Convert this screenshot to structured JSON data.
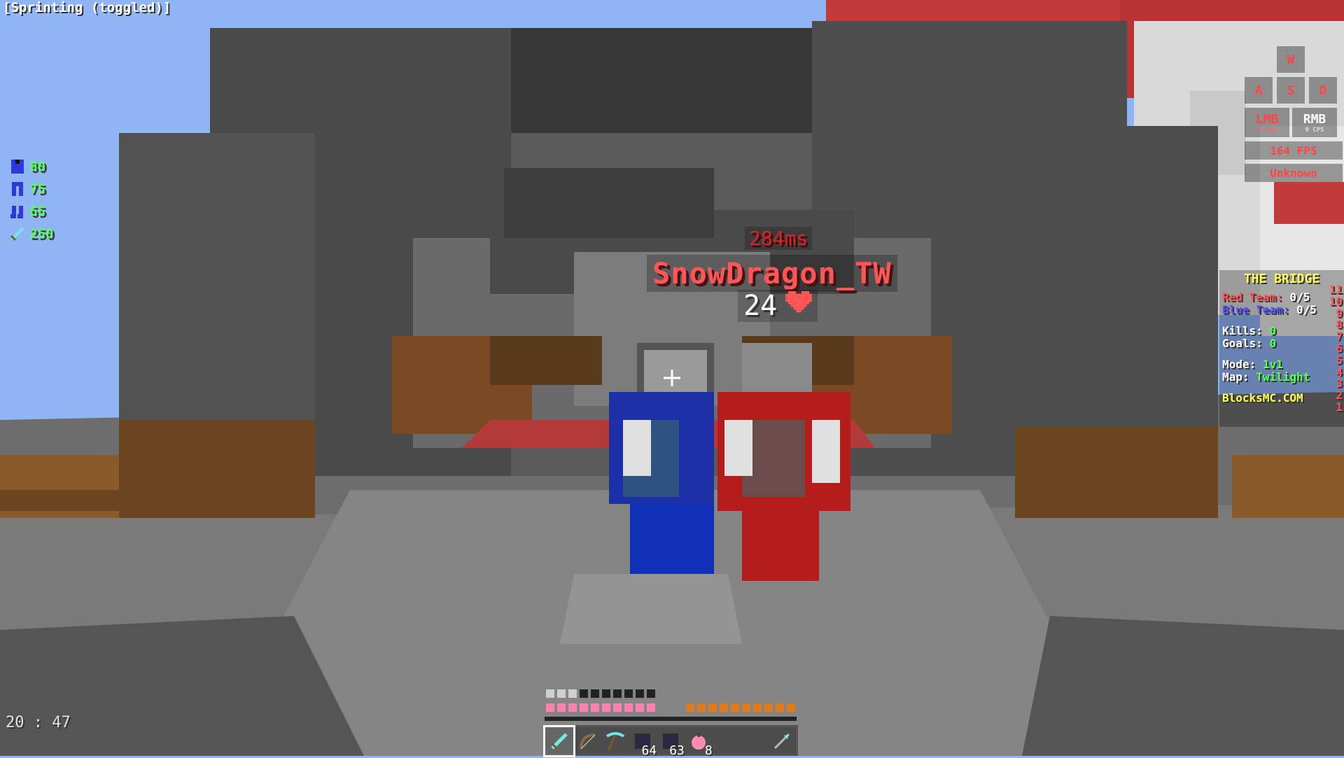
{
  "status": {
    "sprint": "[Sprinting (toggled)]",
    "clock": "20 : 47"
  },
  "armor": [
    {
      "icon": "chestplate-icon",
      "value": "80"
    },
    {
      "icon": "leggings-icon",
      "value": "75"
    },
    {
      "icon": "boots-icon",
      "value": "65"
    },
    {
      "icon": "sword-icon",
      "value": "250"
    }
  ],
  "keystrokes": {
    "w": "W",
    "a": "A",
    "s": "S",
    "d": "D",
    "lmb": "LMB",
    "lmb_cps": "0 CPS",
    "rmb": "RMB",
    "rmb_cps": "0 CPS",
    "fps": "164 FPS",
    "server": "Unknown"
  },
  "target": {
    "ping": "284ms",
    "name": "SnowDragon_TW",
    "health": "24"
  },
  "scoreboard": {
    "title": "THE BRIDGE",
    "red_label": "Red Team:",
    "red_score": "0/5",
    "blue_label": "Blue Team:",
    "blue_score": "0/5",
    "kills_label": "Kills:",
    "kills": "0",
    "goals_label": "Goals:",
    "goals": "0",
    "mode_label": "Mode:",
    "mode": "1v1",
    "map_label": "Map:",
    "map": "Twilight",
    "server": "BlocksMC.COM",
    "numbers": [
      "11",
      "10",
      "9",
      "8",
      "7",
      "6",
      "5",
      "4",
      "3",
      "2",
      "1"
    ]
  },
  "hotbar": {
    "slots": [
      {
        "icon": "diamond-sword-icon",
        "count": ""
      },
      {
        "icon": "bow-icon",
        "count": ""
      },
      {
        "icon": "diamond-pickaxe-icon",
        "count": ""
      },
      {
        "icon": "clay-block-icon",
        "count": "64"
      },
      {
        "icon": "clay-block-icon",
        "count": "63"
      },
      {
        "icon": "golden-apple-icon",
        "count": "8"
      },
      {
        "icon": "empty-slot",
        "count": ""
      },
      {
        "icon": "empty-slot",
        "count": ""
      },
      {
        "icon": "arrow-icon",
        "count": ""
      }
    ],
    "selected": 0
  },
  "colors": {
    "sky": "#8fb5f5",
    "red_team": "#ff5555",
    "blue_team": "#5555ff",
    "accent": "#ffff55"
  }
}
